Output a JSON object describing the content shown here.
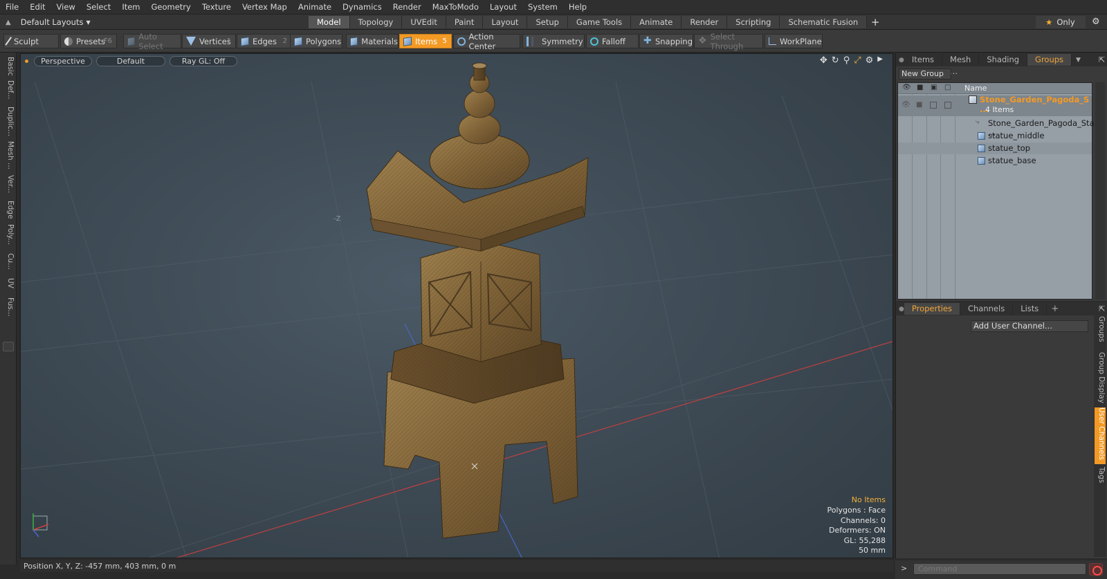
{
  "menu": [
    "File",
    "Edit",
    "View",
    "Select",
    "Item",
    "Geometry",
    "Texture",
    "Vertex Map",
    "Animate",
    "Dynamics",
    "Render",
    "MaxToModo",
    "Layout",
    "System",
    "Help"
  ],
  "layout_dropdown": "Default Layouts",
  "mode_tabs": [
    "Model",
    "Topology",
    "UVEdit",
    "Paint",
    "Layout",
    "Setup",
    "Game Tools",
    "Animate",
    "Render",
    "Scripting",
    "Schematic Fusion"
  ],
  "active_mode_tab": "Model",
  "only_label": "Only",
  "toolbar": {
    "sculpt": "Sculpt",
    "presets": "Presets",
    "presets_key": "F6",
    "auto_select": "Auto Select",
    "vertices": "Vertices",
    "vertices_key": "1",
    "edges": "Edges",
    "edges_key": "2",
    "polygons": "Polygons",
    "materials": "Materials",
    "items": "Items",
    "items_key": "5",
    "action_center": "Action Center",
    "symmetry": "Symmetry",
    "falloff": "Falloff",
    "snapping": "Snapping",
    "select_through": "Select Through",
    "workplane": "WorkPlane"
  },
  "left_tabs": [
    "Basic",
    "Def...",
    "Duplic...",
    "Mesh ...",
    "Ver...",
    "Edge",
    "Poly...",
    "Cu...",
    "UV",
    "Fus..."
  ],
  "viewport": {
    "view": "Perspective",
    "shading": "Default",
    "raygl": "Ray GL: Off",
    "axis_label": "-Z",
    "info": {
      "selection": "No Items",
      "polygons": "Polygons : Face",
      "channels": "Channels: 0",
      "deformers": "Deformers: ON",
      "gl": "GL: 55,288",
      "focal": "50 mm"
    }
  },
  "scene_panel": {
    "tabs": [
      "Items",
      "Mesh ...",
      "Shading",
      "Groups"
    ],
    "active_tab": "Groups",
    "new_group": "New Group",
    "name_header": "Name",
    "group_name": "Stone_Garden_Pagoda_S ...",
    "group_count": "4 Items",
    "items": [
      "Stone_Garden_Pagoda_Sta ...",
      "statue_middle",
      "statue_top",
      "statue_base"
    ]
  },
  "properties_panel": {
    "tabs": [
      "Properties",
      "Channels",
      "Lists"
    ],
    "active_tab": "Properties",
    "add_user_channel": "Add User Channel...",
    "side_tabs": [
      "Groups",
      "Group Display",
      "User Channels",
      "Tags"
    ],
    "active_side_tab": "User Channels"
  },
  "status": {
    "position": "Position X, Y, Z:  -457 mm, 403 mm, 0 m"
  },
  "command_placeholder": "Command",
  "colors": {
    "accent": "#f39a25",
    "viewport_bg": "#3c4852",
    "model_wood": "#8a6a3a"
  }
}
